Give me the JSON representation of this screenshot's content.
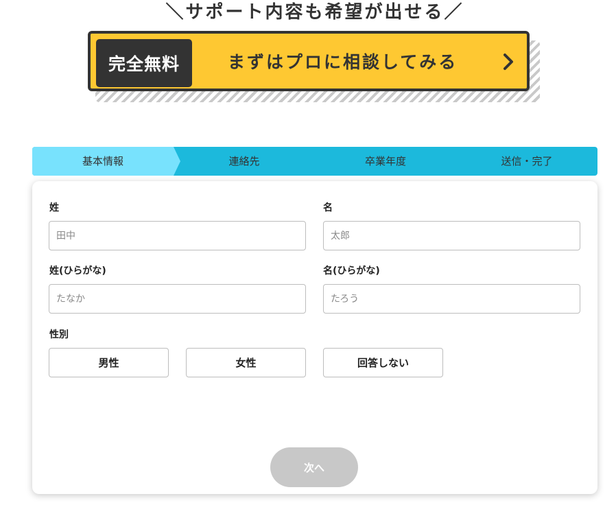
{
  "headline": "＼サポート内容も希望が出せる／",
  "cta": {
    "badge": "完全無料",
    "label": "まずはプロに相談してみる",
    "chevron_icon": "chevron-right-icon"
  },
  "steps": [
    {
      "label": "基本情報",
      "active": true
    },
    {
      "label": "連絡先",
      "active": false
    },
    {
      "label": "卒業年度",
      "active": false
    },
    {
      "label": "送信・完了",
      "active": false
    }
  ],
  "form": {
    "last_name": {
      "label": "姓",
      "placeholder": "田中",
      "value": ""
    },
    "first_name": {
      "label": "名",
      "placeholder": "太郎",
      "value": ""
    },
    "last_name_kana": {
      "label": "姓(ひらがな)",
      "placeholder": "たなか",
      "value": ""
    },
    "first_name_kana": {
      "label": "名(ひらがな)",
      "placeholder": "たろう",
      "value": ""
    },
    "gender": {
      "label": "性別",
      "options": [
        "男性",
        "女性",
        "回答しない"
      ]
    },
    "next_label": "次へ"
  },
  "colors": {
    "cta_bg": "#fec832",
    "dark": "#333333",
    "step_bar": "#1cb9dc",
    "step_active": "#78e2fd",
    "next_disabled": "#c8c8c8"
  }
}
